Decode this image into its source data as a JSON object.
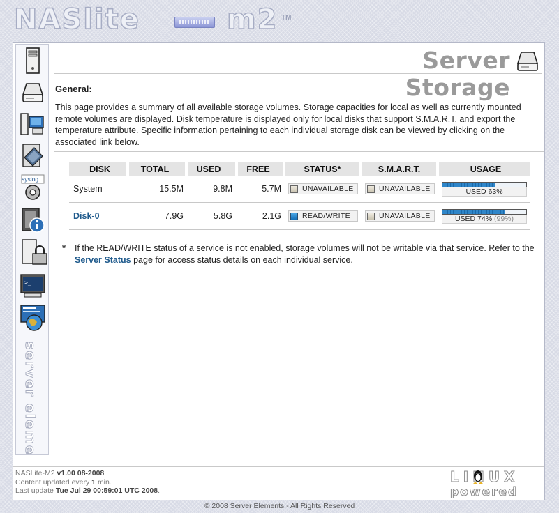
{
  "header": {
    "logo_left": "NASlite",
    "logo_right": "m2",
    "trademark": "TM"
  },
  "page": {
    "title": "Server Storage",
    "section_heading": "General:",
    "intro": "This page provides a summary of all available storage volumes. Storage capacities for local as well as currently mounted remote volumes are displayed. Disk temperature is displayed only for local disks that support S.M.A.R.T. and export the temperature attribute. Specific information pertaining to each individual storage disk can be viewed by clicking on the associated link below."
  },
  "table": {
    "headers": [
      "DISK",
      "TOTAL",
      "USED",
      "FREE",
      "STATUS*",
      "S.M.A.R.T.",
      "USAGE"
    ],
    "rows": [
      {
        "disk": "System",
        "is_link": false,
        "total": "15.5M",
        "used": "9.8M",
        "free": "5.7M",
        "status": "UNAVAILABLE",
        "status_active": false,
        "smart": "UNAVAILABLE",
        "usage_percent": 63,
        "usage_label": "USED 63%",
        "usage_extra": ""
      },
      {
        "disk": "Disk-0",
        "is_link": true,
        "total": "7.9G",
        "used": "5.8G",
        "free": "2.1G",
        "status": "READ/WRITE",
        "status_active": true,
        "smart": "UNAVAILABLE",
        "usage_percent": 74,
        "usage_label": "USED 74%",
        "usage_extra": "(99%)"
      }
    ]
  },
  "note": {
    "star": "*",
    "before": "If the READ/WRITE status of a service is not enabled, storage volumes will not be writable via that service. Refer to the ",
    "link": "Server Status",
    "after": " page for access status details on each individual service."
  },
  "footer": {
    "product": "NASLite-M2",
    "version": "v1.00 08-2008",
    "update_prefix": "Content updated every",
    "update_interval": "1",
    "update_suffix": "min.",
    "last_update_label": "Last update",
    "last_update": "Tue Jul 29 00:59:01 UTC 2008",
    "copyright": "© 2008 Server Elements - All Rights Reserved",
    "badge_top": "LINUX",
    "badge_bottom": "powered"
  },
  "sidebar": {
    "icons": [
      "server-tower-icon",
      "hard-disk-icon",
      "network-computers-icon",
      "file-transfer-icon",
      "syslog-settings-icon",
      "server-info-icon",
      "security-lock-icon",
      "terminal-icon",
      "web-globe-icon"
    ],
    "syslog_label": "syslog",
    "brand": "server elements"
  },
  "colors": {
    "link": "#1f5a8c",
    "usage_fill": "#2f86c9",
    "title": "#9a9a9a",
    "background": "#d8dbe6"
  }
}
